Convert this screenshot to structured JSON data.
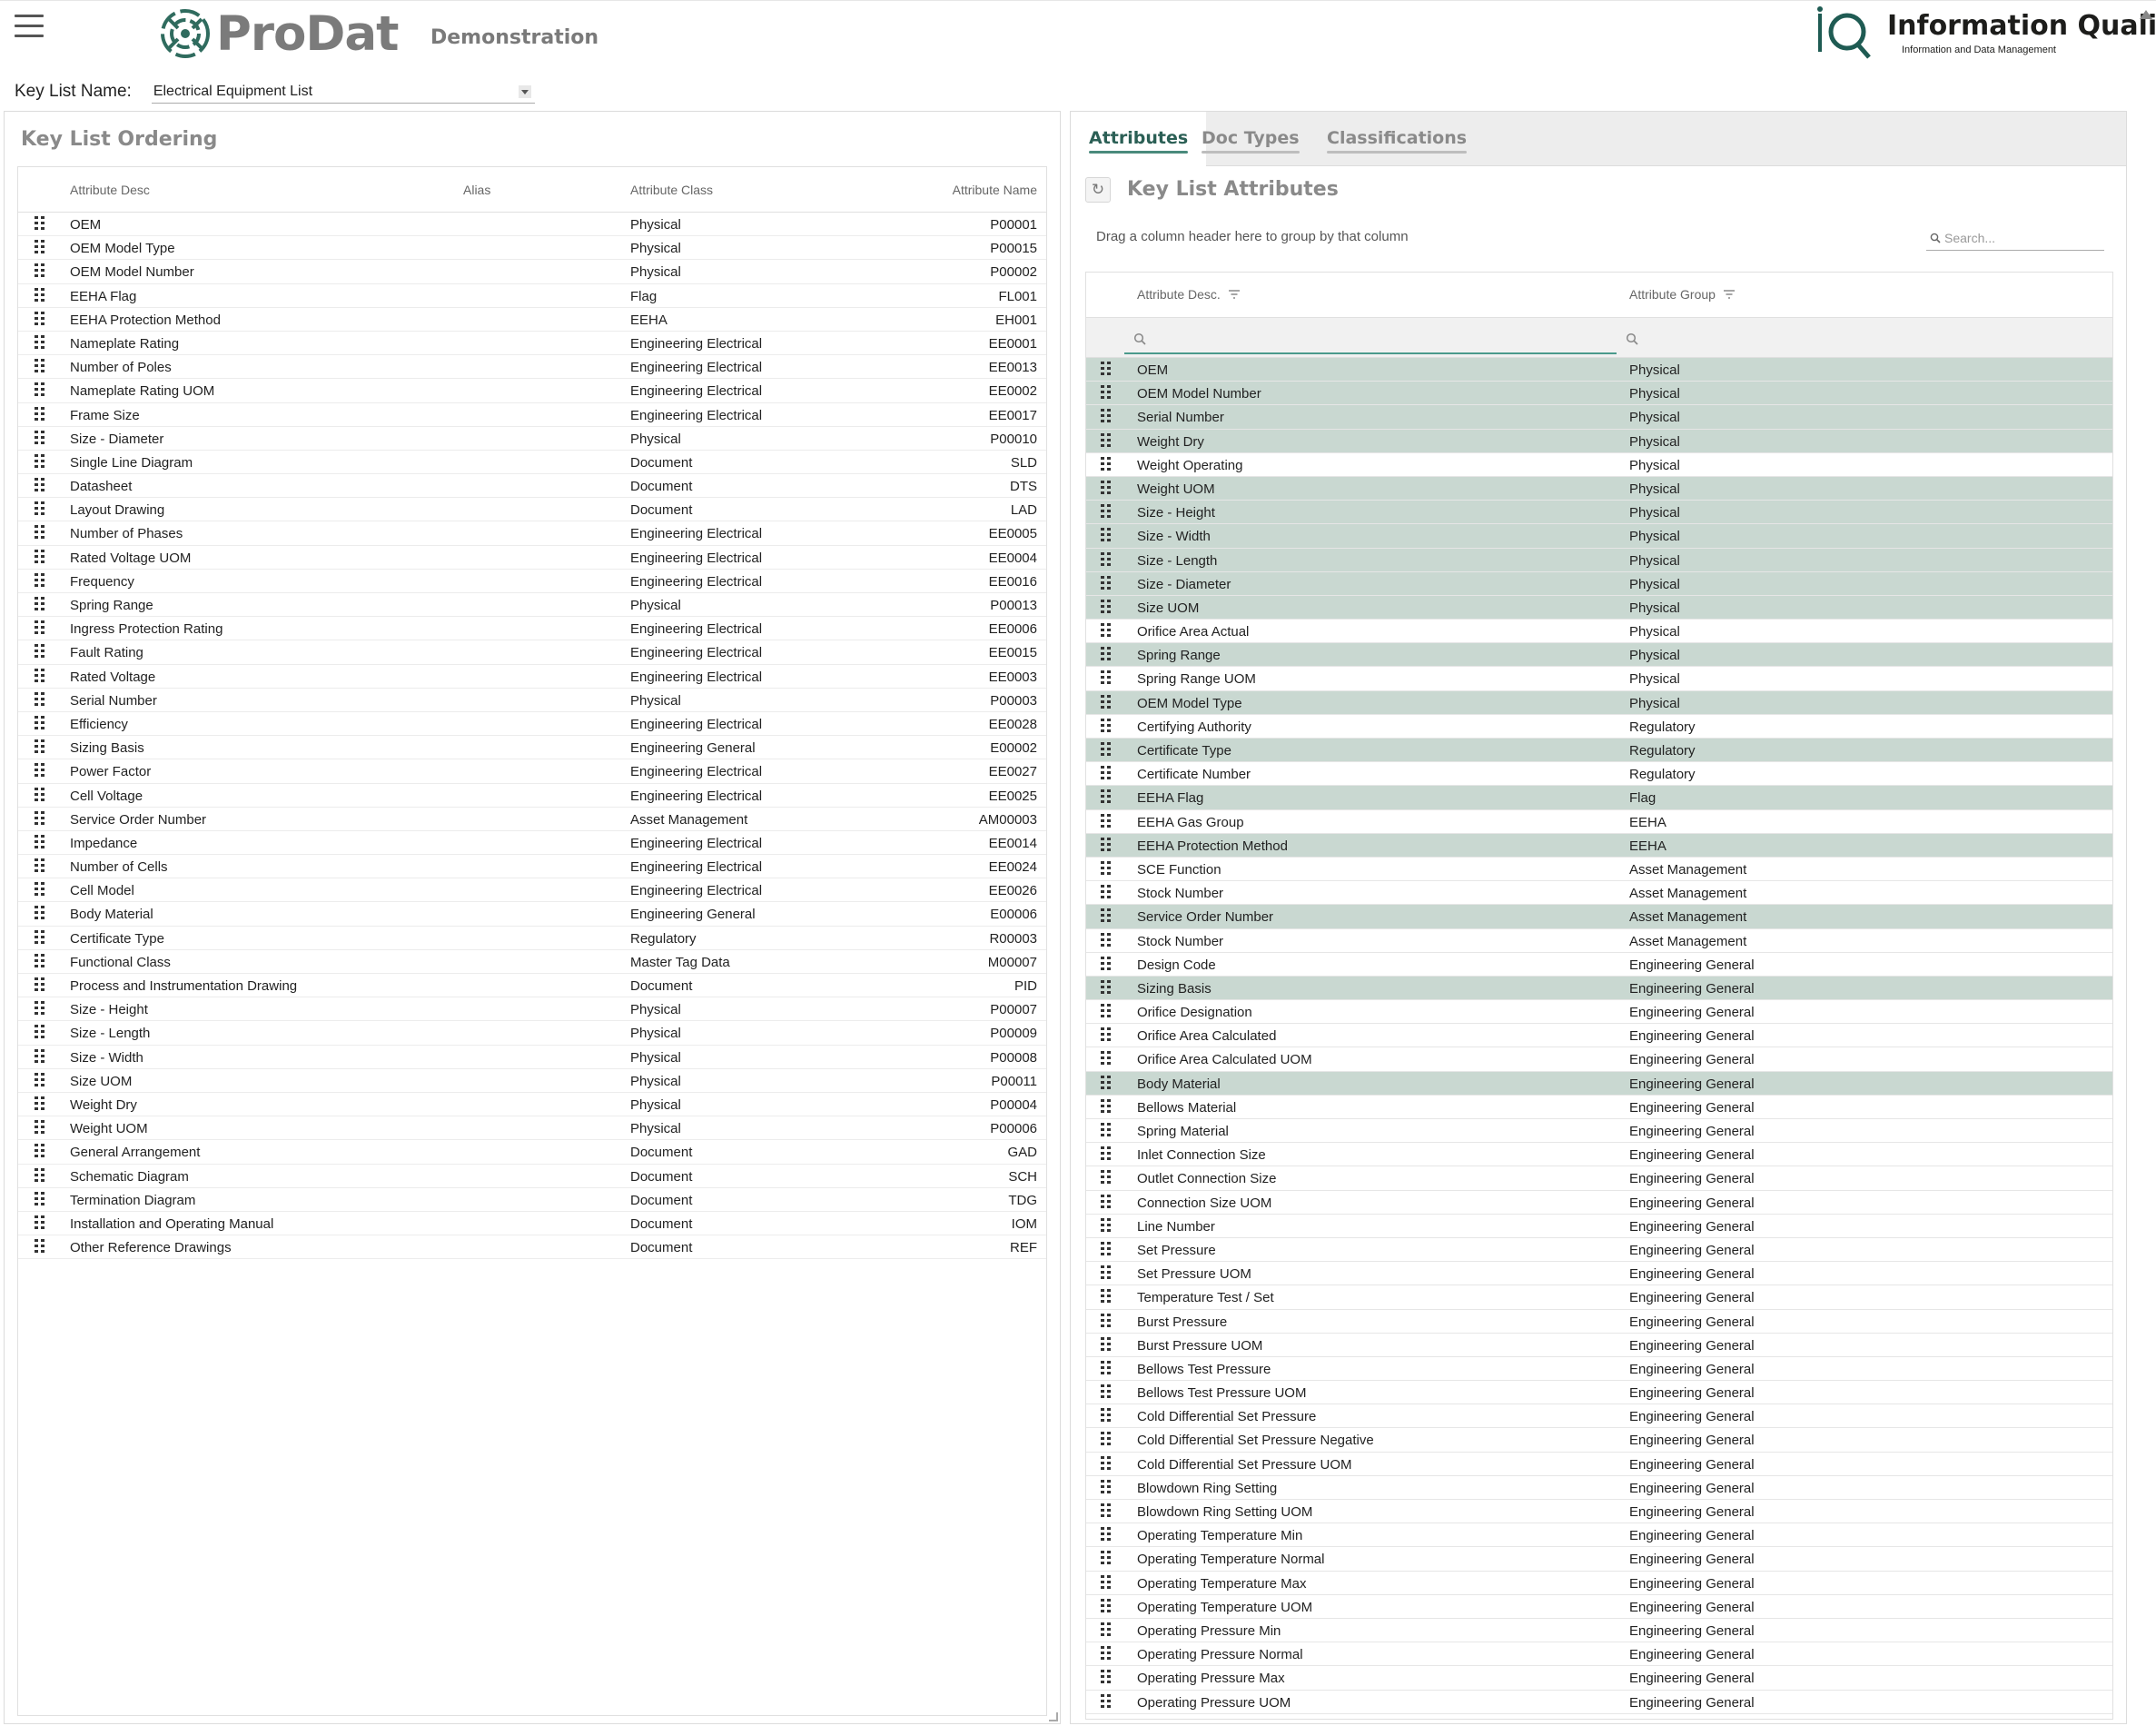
{
  "header": {
    "brand": "ProDat",
    "environment": "Demonstration",
    "iq_title": "Information Quality",
    "iq_subtitle": "Information and Data Management"
  },
  "keylist": {
    "label": "Key List Name:",
    "value": "Electrical Equipment List"
  },
  "left": {
    "title": "Key List Ordering",
    "columns": {
      "desc": "Attribute Desc",
      "alias": "Alias",
      "class": "Attribute Class",
      "name": "Attribute Name"
    },
    "rows": [
      {
        "desc": "OEM",
        "alias": "",
        "class": "Physical",
        "name": "P00001"
      },
      {
        "desc": "OEM Model Type",
        "alias": "",
        "class": "Physical",
        "name": "P00015"
      },
      {
        "desc": "OEM Model Number",
        "alias": "",
        "class": "Physical",
        "name": "P00002"
      },
      {
        "desc": "EEHA Flag",
        "alias": "",
        "class": "Flag",
        "name": "FL001"
      },
      {
        "desc": "EEHA Protection Method",
        "alias": "",
        "class": "EEHA",
        "name": "EH001"
      },
      {
        "desc": "Nameplate Rating",
        "alias": "",
        "class": "Engineering Electrical",
        "name": "EE0001"
      },
      {
        "desc": "Number of Poles",
        "alias": "",
        "class": "Engineering Electrical",
        "name": "EE0013"
      },
      {
        "desc": "Nameplate Rating UOM",
        "alias": "",
        "class": "Engineering Electrical",
        "name": "EE0002"
      },
      {
        "desc": "Frame Size",
        "alias": "",
        "class": "Engineering Electrical",
        "name": "EE0017"
      },
      {
        "desc": "Size - Diameter",
        "alias": "",
        "class": "Physical",
        "name": "P00010"
      },
      {
        "desc": "Single Line Diagram",
        "alias": "",
        "class": "Document",
        "name": "SLD"
      },
      {
        "desc": "Datasheet",
        "alias": "",
        "class": "Document",
        "name": "DTS"
      },
      {
        "desc": "Layout Drawing",
        "alias": "",
        "class": "Document",
        "name": "LAD"
      },
      {
        "desc": "Number of Phases",
        "alias": "",
        "class": "Engineering Electrical",
        "name": "EE0005"
      },
      {
        "desc": "Rated Voltage UOM",
        "alias": "",
        "class": "Engineering Electrical",
        "name": "EE0004"
      },
      {
        "desc": "Frequency",
        "alias": "",
        "class": "Engineering Electrical",
        "name": "EE0016"
      },
      {
        "desc": "Spring Range",
        "alias": "",
        "class": "Physical",
        "name": "P00013"
      },
      {
        "desc": "Ingress Protection Rating",
        "alias": "",
        "class": "Engineering Electrical",
        "name": "EE0006"
      },
      {
        "desc": "Fault Rating",
        "alias": "",
        "class": "Engineering Electrical",
        "name": "EE0015"
      },
      {
        "desc": "Rated Voltage",
        "alias": "",
        "class": "Engineering Electrical",
        "name": "EE0003"
      },
      {
        "desc": "Serial Number",
        "alias": "",
        "class": "Physical",
        "name": "P00003"
      },
      {
        "desc": "Efficiency",
        "alias": "",
        "class": "Engineering Electrical",
        "name": "EE0028"
      },
      {
        "desc": "Sizing Basis",
        "alias": "",
        "class": "Engineering General",
        "name": "E00002"
      },
      {
        "desc": "Power Factor",
        "alias": "",
        "class": "Engineering Electrical",
        "name": "EE0027"
      },
      {
        "desc": "Cell Voltage",
        "alias": "",
        "class": "Engineering Electrical",
        "name": "EE0025"
      },
      {
        "desc": "Service Order Number",
        "alias": "",
        "class": "Asset Management",
        "name": "AM00003"
      },
      {
        "desc": "Impedance",
        "alias": "",
        "class": "Engineering Electrical",
        "name": "EE0014"
      },
      {
        "desc": "Number of Cells",
        "alias": "",
        "class": "Engineering Electrical",
        "name": "EE0024"
      },
      {
        "desc": "Cell Model",
        "alias": "",
        "class": "Engineering Electrical",
        "name": "EE0026"
      },
      {
        "desc": "Body Material",
        "alias": "",
        "class": "Engineering General",
        "name": "E00006"
      },
      {
        "desc": "Certificate Type",
        "alias": "",
        "class": "Regulatory",
        "name": "R00003"
      },
      {
        "desc": "Functional Class",
        "alias": "",
        "class": "Master Tag Data",
        "name": "M00007"
      },
      {
        "desc": "Process and Instrumentation Drawing",
        "alias": "",
        "class": "Document",
        "name": "PID"
      },
      {
        "desc": "Size - Height",
        "alias": "",
        "class": "Physical",
        "name": "P00007"
      },
      {
        "desc": "Size - Length",
        "alias": "",
        "class": "Physical",
        "name": "P00009"
      },
      {
        "desc": "Size - Width",
        "alias": "",
        "class": "Physical",
        "name": "P00008"
      },
      {
        "desc": "Size UOM",
        "alias": "",
        "class": "Physical",
        "name": "P00011"
      },
      {
        "desc": "Weight Dry",
        "alias": "",
        "class": "Physical",
        "name": "P00004"
      },
      {
        "desc": "Weight UOM",
        "alias": "",
        "class": "Physical",
        "name": "P00006"
      },
      {
        "desc": "General Arrangement",
        "alias": "",
        "class": "Document",
        "name": "GAD"
      },
      {
        "desc": "Schematic Diagram",
        "alias": "",
        "class": "Document",
        "name": "SCH"
      },
      {
        "desc": "Termination Diagram",
        "alias": "",
        "class": "Document",
        "name": "TDG"
      },
      {
        "desc": "Installation and Operating Manual",
        "alias": "",
        "class": "Document",
        "name": "IOM"
      },
      {
        "desc": "Other Reference Drawings",
        "alias": "",
        "class": "Document",
        "name": "REF"
      }
    ]
  },
  "right": {
    "tabs": [
      "Attributes",
      "Doc Types",
      "Classifications"
    ],
    "active_tab": "Attributes",
    "title": "Key List Attributes",
    "group_hint": "Drag a column header here to group by that column",
    "search_placeholder": "Search...",
    "columns": {
      "desc": "Attribute Desc.",
      "group": "Attribute Group"
    },
    "selected_row_color": "#c9d8d1",
    "rows": [
      {
        "desc": "OEM",
        "group": "Physical",
        "selected": true
      },
      {
        "desc": "OEM Model Number",
        "group": "Physical",
        "selected": true
      },
      {
        "desc": "Serial Number",
        "group": "Physical",
        "selected": true
      },
      {
        "desc": "Weight Dry",
        "group": "Physical",
        "selected": true
      },
      {
        "desc": "Weight Operating",
        "group": "Physical",
        "selected": false
      },
      {
        "desc": "Weight UOM",
        "group": "Physical",
        "selected": true
      },
      {
        "desc": "Size - Height",
        "group": "Physical",
        "selected": true
      },
      {
        "desc": "Size - Width",
        "group": "Physical",
        "selected": true
      },
      {
        "desc": "Size - Length",
        "group": "Physical",
        "selected": true
      },
      {
        "desc": "Size - Diameter",
        "group": "Physical",
        "selected": true
      },
      {
        "desc": "Size UOM",
        "group": "Physical",
        "selected": true
      },
      {
        "desc": "Orifice Area Actual",
        "group": "Physical",
        "selected": false
      },
      {
        "desc": "Spring Range",
        "group": "Physical",
        "selected": true
      },
      {
        "desc": "Spring Range UOM",
        "group": "Physical",
        "selected": false
      },
      {
        "desc": "OEM Model Type",
        "group": "Physical",
        "selected": true
      },
      {
        "desc": "Certifying Authority",
        "group": "Regulatory",
        "selected": false
      },
      {
        "desc": "Certificate Type",
        "group": "Regulatory",
        "selected": true
      },
      {
        "desc": "Certificate Number",
        "group": "Regulatory",
        "selected": false
      },
      {
        "desc": "EEHA Flag",
        "group": "Flag",
        "selected": true
      },
      {
        "desc": "EEHA Gas Group",
        "group": "EEHA",
        "selected": false
      },
      {
        "desc": "EEHA Protection Method",
        "group": "EEHA",
        "selected": true
      },
      {
        "desc": "SCE Function",
        "group": "Asset Management",
        "selected": false
      },
      {
        "desc": "Stock Number",
        "group": "Asset Management",
        "selected": false
      },
      {
        "desc": "Service Order Number",
        "group": "Asset Management",
        "selected": true
      },
      {
        "desc": "Stock Number",
        "group": "Asset Management",
        "selected": false
      },
      {
        "desc": "Design Code",
        "group": "Engineering General",
        "selected": false
      },
      {
        "desc": "Sizing Basis",
        "group": "Engineering General",
        "selected": true
      },
      {
        "desc": "Orifice Designation",
        "group": "Engineering General",
        "selected": false
      },
      {
        "desc": "Orifice Area Calculated",
        "group": "Engineering General",
        "selected": false
      },
      {
        "desc": "Orifice Area Calculated UOM",
        "group": "Engineering General",
        "selected": false
      },
      {
        "desc": "Body Material",
        "group": "Engineering General",
        "selected": true
      },
      {
        "desc": "Bellows Material",
        "group": "Engineering General",
        "selected": false
      },
      {
        "desc": "Spring Material",
        "group": "Engineering General",
        "selected": false
      },
      {
        "desc": "Inlet Connection Size",
        "group": "Engineering General",
        "selected": false
      },
      {
        "desc": "Outlet Connection Size",
        "group": "Engineering General",
        "selected": false
      },
      {
        "desc": "Connection Size UOM",
        "group": "Engineering General",
        "selected": false
      },
      {
        "desc": "Line Number",
        "group": "Engineering General",
        "selected": false
      },
      {
        "desc": "Set Pressure",
        "group": "Engineering General",
        "selected": false
      },
      {
        "desc": "Set Pressure UOM",
        "group": "Engineering General",
        "selected": false
      },
      {
        "desc": "Temperature Test / Set",
        "group": "Engineering General",
        "selected": false
      },
      {
        "desc": "Burst Pressure",
        "group": "Engineering General",
        "selected": false
      },
      {
        "desc": "Burst Pressure UOM",
        "group": "Engineering General",
        "selected": false
      },
      {
        "desc": "Bellows Test Pressure",
        "group": "Engineering General",
        "selected": false
      },
      {
        "desc": "Bellows Test Pressure UOM",
        "group": "Engineering General",
        "selected": false
      },
      {
        "desc": "Cold Differential Set Pressure",
        "group": "Engineering General",
        "selected": false
      },
      {
        "desc": "Cold Differential Set Pressure Negative",
        "group": "Engineering General",
        "selected": false
      },
      {
        "desc": "Cold Differential Set Pressure UOM",
        "group": "Engineering General",
        "selected": false
      },
      {
        "desc": "Blowdown Ring Setting",
        "group": "Engineering General",
        "selected": false
      },
      {
        "desc": "Blowdown Ring Setting UOM",
        "group": "Engineering General",
        "selected": false
      },
      {
        "desc": "Operating Temperature Min",
        "group": "Engineering General",
        "selected": false
      },
      {
        "desc": "Operating Temperature Normal",
        "group": "Engineering General",
        "selected": false
      },
      {
        "desc": "Operating Temperature Max",
        "group": "Engineering General",
        "selected": false
      },
      {
        "desc": "Operating Temperature UOM",
        "group": "Engineering General",
        "selected": false
      },
      {
        "desc": "Operating Pressure Min",
        "group": "Engineering General",
        "selected": false
      },
      {
        "desc": "Operating Pressure Normal",
        "group": "Engineering General",
        "selected": false
      },
      {
        "desc": "Operating Pressure Max",
        "group": "Engineering General",
        "selected": false
      },
      {
        "desc": "Operating Pressure UOM",
        "group": "Engineering General",
        "selected": false
      }
    ]
  }
}
